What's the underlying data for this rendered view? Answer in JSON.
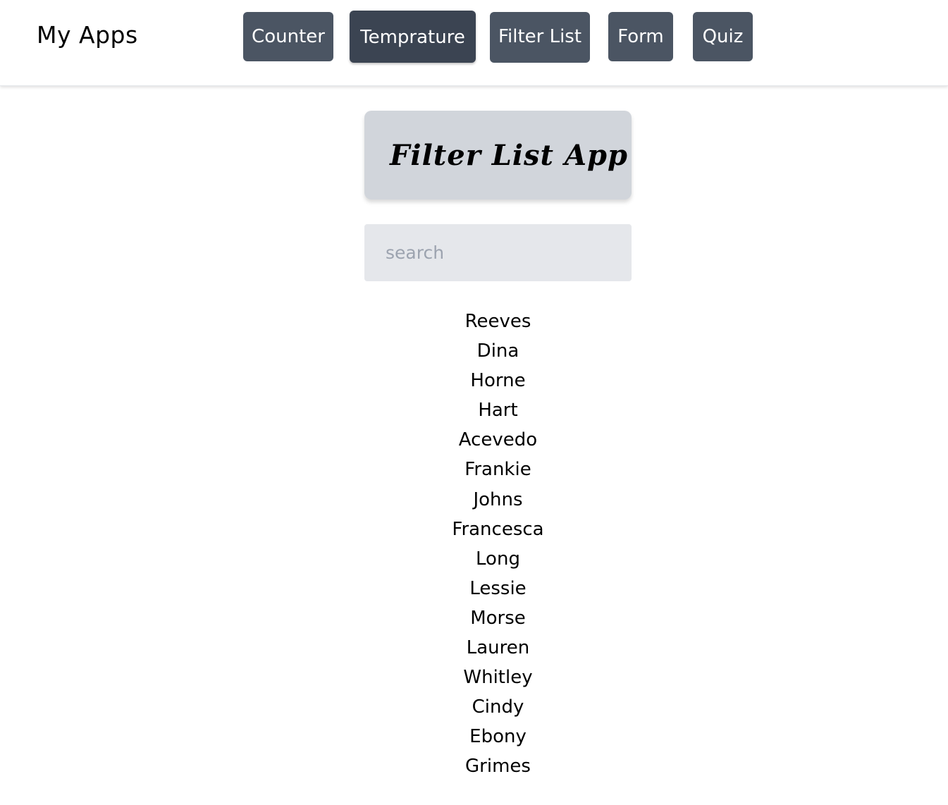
{
  "navbar": {
    "brand": "My Apps",
    "buttons": [
      {
        "label": "Counter"
      },
      {
        "label": "Temprature"
      },
      {
        "label": "Filter List"
      },
      {
        "label": "Form"
      },
      {
        "label": "Quiz"
      }
    ]
  },
  "main": {
    "title": "Filter List App",
    "search": {
      "placeholder": "search",
      "value": ""
    },
    "names": [
      "Reeves",
      "Dina",
      "Horne",
      "Hart",
      "Acevedo",
      "Frankie",
      "Johns",
      "Francesca",
      "Long",
      "Lessie",
      "Morse",
      "Lauren",
      "Whitley",
      "Cindy",
      "Ebony",
      "Grimes"
    ]
  },
  "colors": {
    "nav_button": "#4b5563",
    "title_card": "#d1d5db",
    "search_bg": "#e5e7eb"
  }
}
